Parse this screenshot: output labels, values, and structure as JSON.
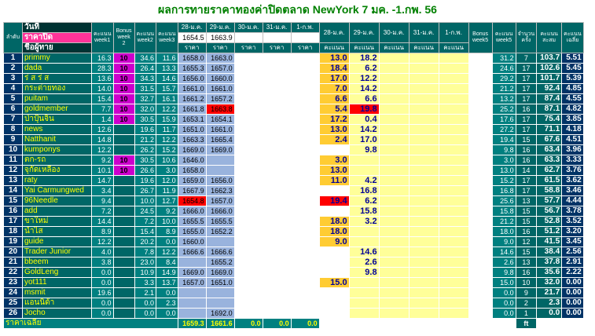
{
  "title": "ผลการทายราคาทองค่าปิดตลาด NewYork 7 มค. -1.กพ. 56",
  "header": {
    "day": "วันที่",
    "close_price": "ราคาปิด",
    "name": "ชื่อผู้ทาย",
    "rank": "ลำดับ",
    "score_week1": "คะแนน week1",
    "bonus_week2": "Bonus week 2",
    "score_week2": "คะแนน week2",
    "score_week3": "คะแนน week3",
    "dates": [
      "28-ม.ค.",
      "29-ม.ค.",
      "30-ม.ค.",
      "31-ม.ค.",
      "1-ก.พ."
    ],
    "closes": [
      "1654.5",
      "1663.9",
      "",
      "",
      ""
    ],
    "price_sub": "ราคา",
    "score_sub": "คะแนน",
    "bonus_week5": "Bonus week5",
    "score_week5": "คะแนน week5",
    "times": "จำนวนครั้ง",
    "total": "คะแนนสะสม",
    "average": "คะแนนเฉลี่ย"
  },
  "rows": [
    {
      "rank": "1",
      "name": "primmy",
      "w1": "16.3",
      "bonus": "10",
      "w2": "34.6",
      "w3": "11.6",
      "p1": "1658.0",
      "p2": "1663.0",
      "s1": "13.0",
      "s2": "18.2",
      "w5": "31.2",
      "cnt": "7",
      "total": "103.7",
      "avg": "5.51"
    },
    {
      "rank": "2",
      "name": "dada",
      "w1": "28.3",
      "bonus": "10",
      "w2": "26.4",
      "w3": "13.3",
      "p1": "1655.3",
      "p2": "1657.0",
      "s1": "18.4",
      "s2": "6.2",
      "w5": "24.6",
      "cnt": "17",
      "total": "102.6",
      "avg": "5.45"
    },
    {
      "rank": "3",
      "name": "ร่ ส ร่ ส",
      "w1": "13.6",
      "bonus": "10",
      "w2": "34.3",
      "w3": "14.6",
      "p1": "1656.0",
      "p2": "1660.0",
      "s1": "17.0",
      "s2": "12.2",
      "w5": "29.2",
      "cnt": "17",
      "total": "101.7",
      "avg": "5.39"
    },
    {
      "rank": "4",
      "name": "กระต่ายทอง",
      "w1": "14.0",
      "bonus": "10",
      "w2": "31.5",
      "w3": "15.7",
      "p1": "1661.0",
      "p2": "1661.0",
      "s1": "7.0",
      "s2": "14.2",
      "w5": "21.2",
      "cnt": "17",
      "total": "92.4",
      "avg": "4.85"
    },
    {
      "rank": "5",
      "name": "puitam",
      "w1": "15.4",
      "bonus": "10",
      "w2": "32.7",
      "w3": "16.1",
      "p1": "1661.2",
      "p2": "1657.2",
      "s1": "6.6",
      "s2": "6.6",
      "w5": "13.2",
      "cnt": "17",
      "total": "87.4",
      "avg": "4.55"
    },
    {
      "rank": "6",
      "name": "goldmember",
      "w1": "7.7",
      "bonus": "10",
      "w2": "32.0",
      "w3": "12.2",
      "p1": "1661.8",
      "p2": "1663.8",
      "s1": "5.4",
      "s2": "19.8",
      "w5": "25.2",
      "cnt": "16",
      "total": "87.1",
      "avg": "4.82"
    },
    {
      "rank": "7",
      "name": "ป่าปุ้นจิ้น",
      "w1": "1.4",
      "bonus": "10",
      "w2": "30.5",
      "w3": "15.9",
      "p1": "1653.1",
      "p2": "1654.1",
      "s1": "17.2",
      "s2": "0.4",
      "w5": "17.6",
      "cnt": "17",
      "total": "75.4",
      "avg": "3.85"
    },
    {
      "rank": "8",
      "name": "news",
      "w1": "12.6",
      "bonus": "",
      "w2": "19.6",
      "w3": "11.7",
      "p1": "1651.0",
      "p2": "1661.0",
      "s1": "13.0",
      "s2": "14.2",
      "w5": "27.2",
      "cnt": "17",
      "total": "71.1",
      "avg": "4.18"
    },
    {
      "rank": "9",
      "name": "Natthanit",
      "w1": "14.8",
      "bonus": "",
      "w2": "21.2",
      "w3": "12.2",
      "p1": "1663.3",
      "p2": "1665.4",
      "s1": "2.4",
      "s2": "17.0",
      "w5": "19.4",
      "cnt": "15",
      "total": "67.6",
      "avg": "4.51"
    },
    {
      "rank": "10",
      "name": "kumponys",
      "w1": "12.2",
      "bonus": "",
      "w2": "26.2",
      "w3": "15.2",
      "p1": "1669.0",
      "p2": "1669.0",
      "s1": "",
      "s2": "9.8",
      "w5": "9.8",
      "cnt": "16",
      "total": "63.4",
      "avg": "3.96"
    },
    {
      "rank": "11",
      "name": "ตก-รถ",
      "w1": "9.2",
      "bonus": "10",
      "w2": "30.5",
      "w3": "10.6",
      "p1": "1646.0",
      "p2": "",
      "s1": "3.0",
      "s2": "",
      "w5": "3.0",
      "cnt": "16",
      "total": "63.3",
      "avg": "3.33"
    },
    {
      "rank": "12",
      "name": "จุกัดเหลือง",
      "w1": "10.1",
      "bonus": "10",
      "w2": "26.6",
      "w3": "3.0",
      "p1": "1658.0",
      "p2": "",
      "s1": "13.0",
      "s2": "",
      "w5": "13.0",
      "cnt": "14",
      "total": "62.7",
      "avg": "3.76"
    },
    {
      "rank": "13",
      "name": "raty",
      "w1": "14.7",
      "bonus": "",
      "w2": "19.6",
      "w3": "12.0",
      "p1": "1659.0",
      "p2": "1656.0",
      "s1": "11.0",
      "s2": "4.2",
      "w5": "15.2",
      "cnt": "17",
      "total": "61.5",
      "avg": "3.62"
    },
    {
      "rank": "14",
      "name": "Yai Carmungwed",
      "w1": "3.4",
      "bonus": "",
      "w2": "26.7",
      "w3": "11.9",
      "p1": "1667.9",
      "p2": "1662.3",
      "s1": "",
      "s2": "16.8",
      "w5": "16.8",
      "cnt": "17",
      "total": "58.8",
      "avg": "3.46"
    },
    {
      "rank": "15",
      "name": "96Needle",
      "w1": "9.4",
      "bonus": "",
      "w2": "10.0",
      "w3": "12.7",
      "p1": "1654.8",
      "p2": "1657.0",
      "s1": "19.4",
      "s2": "6.2",
      "w5": "25.6",
      "cnt": "13",
      "total": "57.7",
      "avg": "4.44"
    },
    {
      "rank": "16",
      "name": "add",
      "w1": "7.2",
      "bonus": "",
      "w2": "24.5",
      "w3": "9.2",
      "p1": "1666.0",
      "p2": "1666.0",
      "s1": "",
      "s2": "15.8",
      "w5": "15.8",
      "cnt": "15",
      "total": "56.7",
      "avg": "3.78"
    },
    {
      "rank": "17",
      "name": "ขาใหม่",
      "w1": "14.4",
      "bonus": "",
      "w2": "7.2",
      "w3": "10.0",
      "p1": "1655.5",
      "p2": "1655.5",
      "s1": "18.0",
      "s2": "3.2",
      "w5": "21.2",
      "cnt": "15",
      "total": "52.8",
      "avg": "3.52"
    },
    {
      "rank": "18",
      "name": "น้ำไส",
      "w1": "8.9",
      "bonus": "",
      "w2": "15.4",
      "w3": "8.9",
      "p1": "1655.0",
      "p2": "1652.2",
      "s1": "18.0",
      "s2": "",
      "w5": "18.0",
      "cnt": "16",
      "total": "51.2",
      "avg": "3.20"
    },
    {
      "rank": "19",
      "name": "guide",
      "w1": "12.2",
      "bonus": "",
      "w2": "20.2",
      "w3": "0.0",
      "p1": "1660.0",
      "p2": "",
      "s1": "9.0",
      "s2": "",
      "w5": "9.0",
      "cnt": "12",
      "total": "41.5",
      "avg": "3.45"
    },
    {
      "rank": "20",
      "name": "Trader Junior",
      "w1": "4.0",
      "bonus": "",
      "w2": "7.8",
      "w3": "12.2",
      "p1": "1666.6",
      "p2": "1666.6",
      "s1": "",
      "s2": "14.6",
      "w5": "14.6",
      "cnt": "15",
      "total": "38.4",
      "avg": "2.56"
    },
    {
      "rank": "21",
      "name": "bbeem",
      "w1": "3.8",
      "bonus": "",
      "w2": "23.0",
      "w3": "8.4",
      "p1": "",
      "p2": "1655.2",
      "s1": "",
      "s2": "2.6",
      "w5": "2.6",
      "cnt": "13",
      "total": "37.8",
      "avg": "2.91"
    },
    {
      "rank": "22",
      "name": "GoldLeng",
      "w1": "0.0",
      "bonus": "",
      "w2": "10.9",
      "w3": "14.9",
      "p1": "1669.0",
      "p2": "1669.0",
      "s1": "",
      "s2": "9.8",
      "w5": "9.8",
      "cnt": "16",
      "total": "35.6",
      "avg": "2.22"
    },
    {
      "rank": "23",
      "name": "yot111",
      "w1": "0.0",
      "bonus": "",
      "w2": "3.3",
      "w3": "13.7",
      "p1": "1657.0",
      "p2": "1651.0",
      "s1": "15.0",
      "s2": "",
      "w5": "15.0",
      "cnt": "10",
      "total": "32.0",
      "avg": "0.00"
    },
    {
      "rank": "24",
      "name": "msmit",
      "w1": "19.6",
      "bonus": "",
      "w2": "2.1",
      "w3": "0.0",
      "p1": "",
      "p2": "",
      "s1": "",
      "s2": "",
      "w5": "0.0",
      "cnt": "9",
      "total": "21.7",
      "avg": "0.00"
    },
    {
      "rank": "25",
      "name": "แอนนิด้า",
      "w1": "0.0",
      "bonus": "",
      "w2": "0.0",
      "w3": "2.3",
      "p1": "",
      "p2": "",
      "s1": "",
      "s2": "",
      "w5": "0.0",
      "cnt": "2",
      "total": "2.3",
      "avg": "0.00"
    },
    {
      "rank": "26",
      "name": "Jocho",
      "w1": "0.0",
      "bonus": "",
      "w2": "0.0",
      "w3": "0.0",
      "p1": "",
      "p2": "1692.0",
      "s1": "",
      "s2": "",
      "w5": "0.0",
      "cnt": "1",
      "total": "0.0",
      "avg": "0.00"
    }
  ],
  "footer": {
    "label": "ราคาเฉลี่ย",
    "avgs": [
      "1659.3",
      "1661.6",
      "0.0",
      "0.0",
      "0.0"
    ],
    "ft": "ft"
  },
  "highlights": {
    "bonus": [
      "1",
      "2",
      "3",
      "4",
      "5",
      "6",
      "7",
      "11",
      "12"
    ],
    "red_price": [
      {
        "row": 6,
        "col": "p2"
      },
      {
        "row": 15,
        "col": "p1"
      }
    ],
    "red_score": [
      {
        "row": 6,
        "col": "s2"
      },
      {
        "row": 15,
        "col": "s1"
      }
    ]
  },
  "colors": {
    "title": "#008000",
    "header_bg": "#006666",
    "name_text": "#ffff00",
    "bonus_bg": "#cc00cc",
    "price_bg": "#99b3dd",
    "score_orange": "#ffcc33",
    "score_yellow": "#ffff99",
    "red": "#ff0000",
    "rank_bg": "#003366"
  }
}
